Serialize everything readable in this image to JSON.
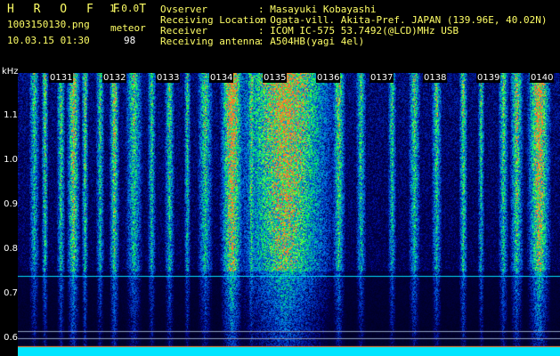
{
  "header": {
    "app_name": "H R O F F T",
    "version": "1.0.0",
    "file_name": "1003150130.png",
    "timestamp": "10.03.15 01:30",
    "meteor_label": "meteor",
    "meteor_count": "98"
  },
  "info": [
    {
      "label": "Ovserver",
      "value": ": Masayuki Kobayashi"
    },
    {
      "label": "Receiving Location",
      "value": ": Ogata-vill. Akita-Pref. JAPAN (139.96E, 40.02N)"
    },
    {
      "label": "Receiver",
      "value": ": ICOM IC-575 53.7492(@LCD)MHz USB"
    },
    {
      "label": "Receiving antenna",
      "value": ": A504HB(yagi 4el)"
    }
  ],
  "axis": {
    "unit": "kHz",
    "y_ticks": [
      "1.1",
      "1.0",
      "0.9",
      "0.8",
      "0.7",
      "0.6"
    ],
    "time_marks": [
      "0131",
      "0132",
      "0133",
      "0134",
      "0135",
      "0136",
      "0137",
      "0138",
      "0139",
      "0140"
    ]
  },
  "colors": {
    "header_text": "#ffff66",
    "value_text": "#ffffff",
    "background": "#000000",
    "noise_low": "#0a1a8a",
    "noise_mid": "#1e90ff",
    "noise_high": "#00ff80",
    "hot": "#ff3030",
    "baseline": "#00e5ff"
  }
}
